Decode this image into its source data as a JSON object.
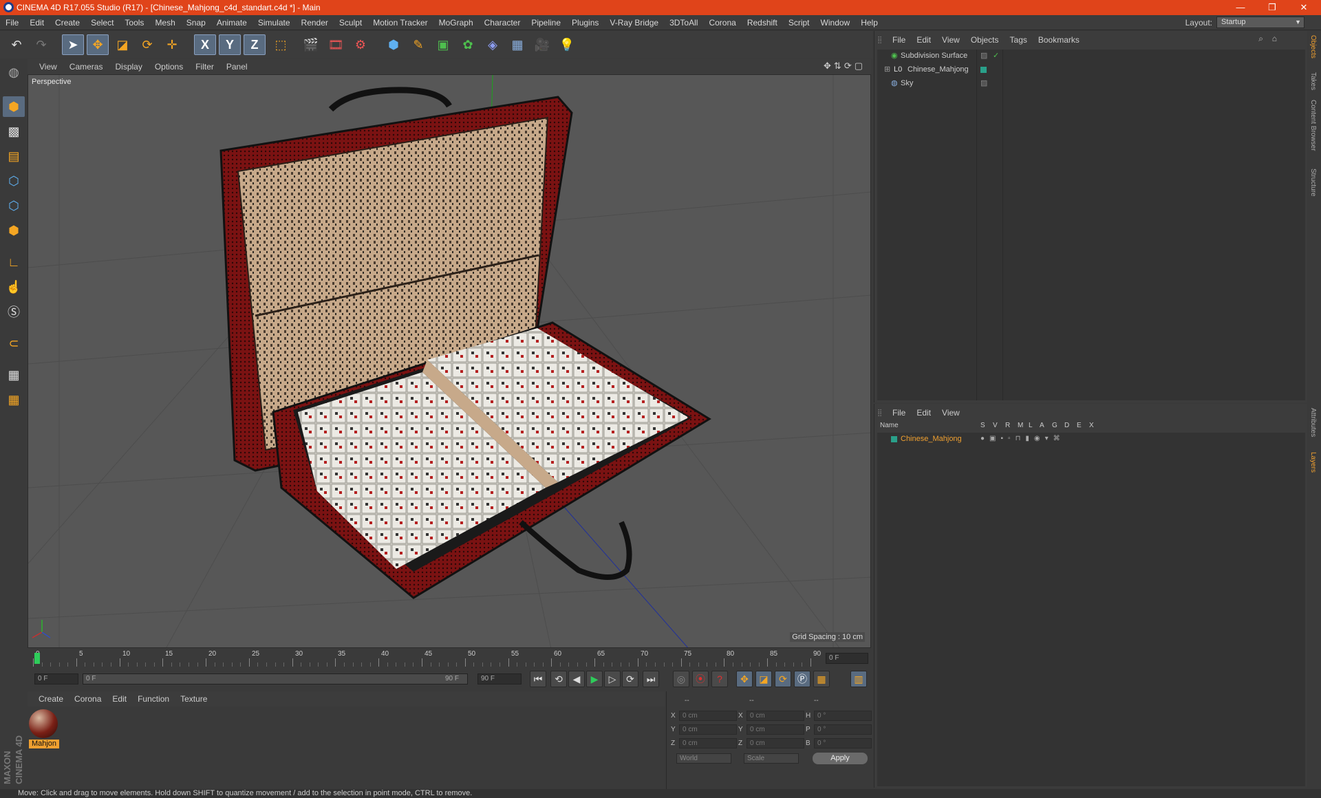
{
  "window": {
    "title": "CINEMA 4D R17.055 Studio (R17) - [Chinese_Mahjong_c4d_standart.c4d *] - Main",
    "controls": [
      "—",
      "❐",
      "✕"
    ]
  },
  "menubar": {
    "items": [
      "File",
      "Edit",
      "Create",
      "Select",
      "Tools",
      "Mesh",
      "Snap",
      "Animate",
      "Simulate",
      "Render",
      "Sculpt",
      "Motion Tracker",
      "MoGraph",
      "Character",
      "Pipeline",
      "Plugins",
      "V-Ray Bridge",
      "3DToAll",
      "Corona",
      "Redshift",
      "Script",
      "Window",
      "Help"
    ],
    "layout_label": "Layout:",
    "layout_value": "Startup"
  },
  "toolbar": {
    "icons": [
      "undo-icon",
      "redo-icon",
      "select-arrow-icon",
      "move-icon",
      "scale-icon",
      "rotate-icon",
      "live-select-icon",
      "x-axis-icon",
      "y-axis-icon",
      "z-axis-icon",
      "coordinate-system-icon",
      "render-view-icon",
      "render-picture-viewer-icon",
      "render-settings-icon",
      "cube-icon",
      "spline-pen-icon",
      "subdivision-icon",
      "cloner-icon",
      "deformer-icon",
      "floor-icon",
      "camera-icon",
      "light-icon"
    ],
    "axis_labels": [
      "X",
      "Y",
      "Z"
    ]
  },
  "viewport": {
    "menu": [
      "View",
      "Cameras",
      "Display",
      "Options",
      "Filter",
      "Panel"
    ],
    "label": "Perspective",
    "grid_spacing": "Grid Spacing : 10 cm"
  },
  "timeline": {
    "ticks": [
      "0",
      "5",
      "10",
      "15",
      "20",
      "25",
      "30",
      "35",
      "40",
      "45",
      "50",
      "55",
      "60",
      "65",
      "70",
      "75",
      "80",
      "85",
      "90"
    ],
    "current_frame_field": "0 F",
    "start_field": "0 F",
    "range_start": "0 F",
    "range_end": "90 F",
    "end_field": "90 F"
  },
  "material_manager": {
    "menu": [
      "Create",
      "Corona",
      "Edit",
      "Function",
      "Texture"
    ],
    "materials": [
      {
        "name": "Mahjon"
      }
    ]
  },
  "coordinates": {
    "headers": [
      "--",
      "--",
      "--"
    ],
    "rows": [
      {
        "a": "X",
        "av": "0 cm",
        "b": "X",
        "bv": "0 cm",
        "c": "H",
        "cv": "0 °"
      },
      {
        "a": "Y",
        "av": "0 cm",
        "b": "Y",
        "bv": "0 cm",
        "c": "P",
        "cv": "0 °"
      },
      {
        "a": "Z",
        "av": "0 cm",
        "b": "Z",
        "bv": "0 cm",
        "c": "B",
        "cv": "0 °"
      }
    ],
    "mode_world": "World",
    "mode_scale": "Scale",
    "apply_label": "Apply"
  },
  "object_manager": {
    "menu": [
      "File",
      "Edit",
      "View",
      "Objects",
      "Tags",
      "Bookmarks"
    ],
    "objects": [
      {
        "name": "Subdivision Surface",
        "indent": 0
      },
      {
        "name": "Chinese_Mahjong",
        "indent": 1
      },
      {
        "name": "Sky",
        "indent": 0
      }
    ]
  },
  "layer_manager": {
    "menu": [
      "File",
      "Edit",
      "View"
    ],
    "columns": [
      "Name",
      "S",
      "V",
      "R",
      "M",
      "L",
      "A",
      "G",
      "D",
      "E",
      "X"
    ],
    "layers": [
      {
        "name": "Chinese_Mahjong",
        "color": "#2aa08a"
      }
    ]
  },
  "side_tabs": {
    "top": [
      "Objects",
      "Takes",
      "Content Browser",
      "Structure"
    ],
    "bottom": [
      "Attributes",
      "Layers"
    ]
  },
  "branding": {
    "logo": "MAXON CINEMA 4D"
  },
  "status": "Move: Click and drag to move elements. Hold down SHIFT to quantize movement / add to the selection in point mode, CTRL to remove.",
  "colors": {
    "accent": "#e0441a",
    "selection": "#596b80",
    "layer": "#2aa08a",
    "active_text": "#f0a030"
  }
}
